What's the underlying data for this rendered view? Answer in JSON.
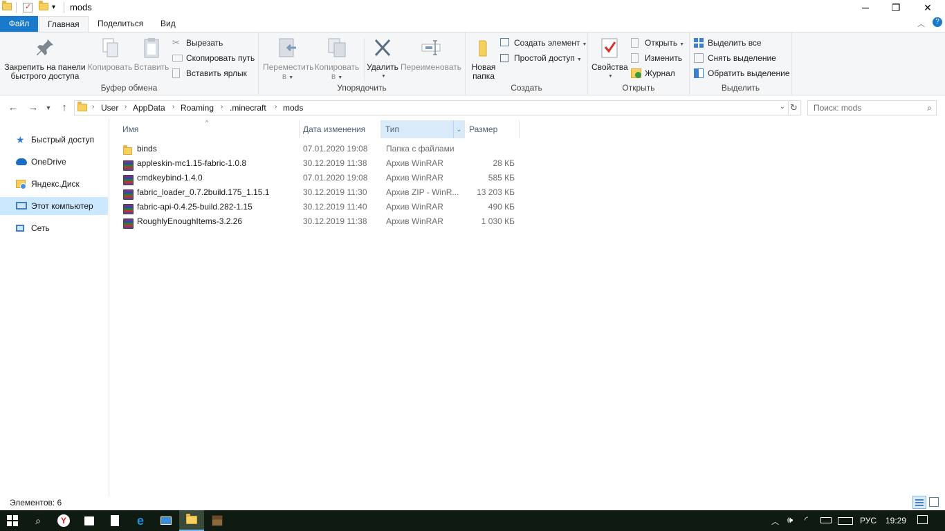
{
  "window": {
    "title": "mods",
    "minimize_label": "─",
    "restore_label": "❐",
    "close_label": "✕",
    "qat_dropdown": "▾"
  },
  "ribbon_tabs": [
    {
      "label": "Файл"
    },
    {
      "label": "Главная"
    },
    {
      "label": "Поделиться"
    },
    {
      "label": "Вид"
    }
  ],
  "ribbon": {
    "clipboard": {
      "group_label": "Буфер обмена",
      "pin_label_1": "Закрепить на панели",
      "pin_label_2": "быстрого доступа",
      "copy_label": "Копировать",
      "paste_label": "Вставить",
      "cut_label": "Вырезать",
      "copy_path_label": "Скопировать путь",
      "paste_shortcut_label": "Вставить ярлык"
    },
    "organize": {
      "group_label": "Упорядочить",
      "move_label_1": "Переместить",
      "move_label_2": "в",
      "copyto_label_1": "Копировать",
      "copyto_label_2": "в",
      "delete_label": "Удалить",
      "rename_label": "Переименовать"
    },
    "new": {
      "group_label": "Создать",
      "new_folder_1": "Новая",
      "new_folder_2": "папка",
      "new_item_label": "Создать элемент",
      "easy_access_label": "Простой доступ"
    },
    "open": {
      "group_label": "Открыть",
      "properties_label": "Свойства",
      "open_label": "Открыть",
      "edit_label": "Изменить",
      "history_label": "Журнал"
    },
    "select": {
      "group_label": "Выделить",
      "select_all_label": "Выделить все",
      "select_none_label": "Снять выделение",
      "invert_label": "Обратить выделение"
    }
  },
  "address": {
    "crumbs": [
      "User",
      "AppData",
      "Roaming",
      ".minecraft",
      "mods"
    ],
    "search_placeholder": "Поиск: mods"
  },
  "nav_pane": {
    "items": [
      {
        "label": "Быстрый доступ",
        "icon": "star-icon"
      },
      {
        "label": "OneDrive",
        "icon": "cloud-icon"
      },
      {
        "label": "Яндекс.Диск",
        "icon": "yandex-disk-icon"
      },
      {
        "label": "Этот компьютер",
        "icon": "computer-icon",
        "selected": true
      },
      {
        "label": "Сеть",
        "icon": "network-icon"
      }
    ]
  },
  "columns": {
    "name": "Имя",
    "date": "Дата изменения",
    "type": "Тип",
    "size": "Размер"
  },
  "files": [
    {
      "name": "binds",
      "date": "07.01.2020 19:08",
      "type": "Папка с файлами",
      "size": "",
      "icon": "folder-icon"
    },
    {
      "name": "appleskin-mc1.15-fabric-1.0.8",
      "date": "30.12.2019 11:38",
      "type": "Архив WinRAR",
      "size": "28 КБ",
      "icon": "winrar-icon"
    },
    {
      "name": "cmdkeybind-1.4.0",
      "date": "07.01.2020 19:08",
      "type": "Архив WinRAR",
      "size": "585 КБ",
      "icon": "winrar-icon"
    },
    {
      "name": "fabric_loader_0.7.2build.175_1.15.1",
      "date": "30.12.2019 11:30",
      "type": "Архив ZIP - WinR...",
      "size": "13 203 КБ",
      "icon": "winrar-icon"
    },
    {
      "name": "fabric-api-0.4.25-build.282-1.15",
      "date": "30.12.2019 11:40",
      "type": "Архив WinRAR",
      "size": "490 КБ",
      "icon": "winrar-icon"
    },
    {
      "name": "RoughlyEnoughItems-3.2.26",
      "date": "30.12.2019 11:38",
      "type": "Архив WinRAR",
      "size": "1 030 КБ",
      "icon": "winrar-icon"
    }
  ],
  "status": {
    "items_count": "Элементов: 6"
  },
  "taskbar": {
    "language": "РУС",
    "time": "19:29"
  },
  "colors": {
    "file_tab": "#1979ca",
    "selection": "#cce8ff",
    "taskbar": "#0f1a10"
  }
}
